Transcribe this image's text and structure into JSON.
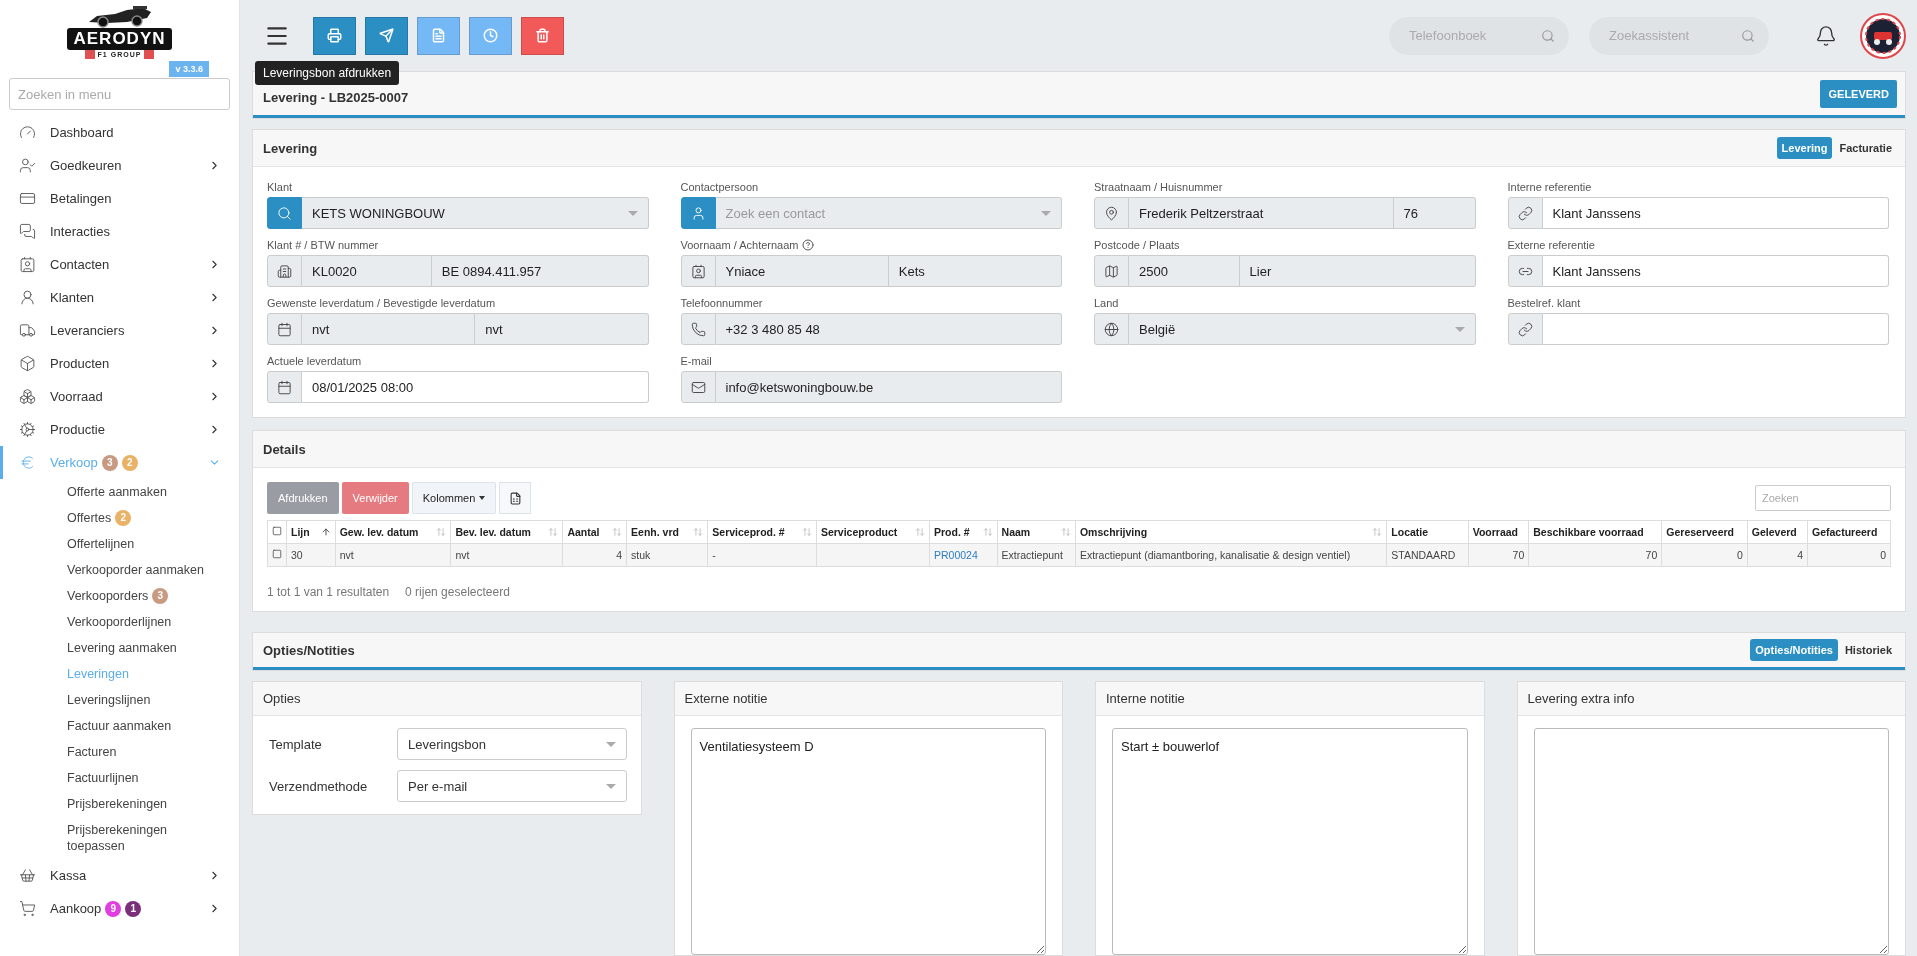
{
  "sidebar": {
    "brand": "AERODYN",
    "brand_subtitle": "F1 GROUP",
    "version": "v 3.3.6",
    "search": {
      "placeholder": "Zoeken in menu"
    },
    "items": [
      {
        "label": "Dashboard",
        "active": false
      },
      {
        "label": "Goedkeuren",
        "submenu": true,
        "active": false
      },
      {
        "label": "Betalingen",
        "active": false
      },
      {
        "label": "Interacties",
        "active": false
      },
      {
        "label": "Contacten",
        "submenu": true,
        "active": false
      },
      {
        "label": "Klanten",
        "submenu": true,
        "active": false
      },
      {
        "label": "Leveranciers",
        "submenu": true,
        "active": false
      },
      {
        "label": "Producten",
        "submenu": true,
        "active": false
      },
      {
        "label": "Voorraad",
        "submenu": true,
        "active": false
      },
      {
        "label": "Productie",
        "submenu": true,
        "active": false
      },
      {
        "label": "Verkoop",
        "submenu": true,
        "active": true,
        "expanded": true,
        "badges": [
          {
            "text": "3",
            "color": "#c99a82"
          },
          {
            "text": "2",
            "color": "#e9b266"
          }
        ],
        "children": [
          {
            "label": "Offerte aanmaken",
            "selected": false
          },
          {
            "label": "Offertes",
            "selected": false,
            "badges": [
              {
                "text": "2",
                "color": "#e9b266"
              }
            ]
          },
          {
            "label": "Offertelijnen",
            "selected": false
          },
          {
            "label": "Verkooporder aanmaken",
            "selected": false
          },
          {
            "label": "Verkooporders",
            "selected": false,
            "badges": [
              {
                "text": "3",
                "color": "#c99a82"
              }
            ]
          },
          {
            "label": "Verkooporderlijnen",
            "selected": false
          },
          {
            "label": "Levering aanmaken",
            "selected": false
          },
          {
            "label": "Leveringen",
            "selected": true
          },
          {
            "label": "Leveringslijnen",
            "selected": false
          },
          {
            "label": "Factuur aanmaken",
            "selected": false
          },
          {
            "label": "Facturen",
            "selected": false
          },
          {
            "label": "Factuurlijnen",
            "selected": false
          },
          {
            "label": "Prijsberekeningen",
            "selected": false
          },
          {
            "label": "Prijsberekeningen toepassen",
            "selected": false
          }
        ]
      },
      {
        "label": "Kassa",
        "submenu": true,
        "active": false
      },
      {
        "label": "Aankoop",
        "submenu": true,
        "active": false,
        "badges": [
          {
            "text": "9",
            "color": "#e03ee0"
          },
          {
            "text": "1",
            "color": "#7b2f7b"
          }
        ]
      }
    ]
  },
  "toolbar": {
    "buttons": [
      {
        "color": "#2b8fc4"
      },
      {
        "color": "#2b8fc4"
      },
      {
        "color": "#74b8f5"
      },
      {
        "color": "#74b8f5"
      },
      {
        "color": "#f25a5a"
      }
    ],
    "tooltip": "Leveringsbon afdrukken",
    "searches": [
      {
        "placeholder": "Telefoonboek"
      },
      {
        "placeholder": "Zoekassistent"
      }
    ]
  },
  "header": {
    "title": "Levering - LB2025-0007",
    "status": "GELEVERD"
  },
  "levering": {
    "title": "Levering",
    "tabs": [
      {
        "label": "Levering",
        "selected": true
      },
      {
        "label": "Facturatie",
        "selected": false
      }
    ],
    "columns": [
      {
        "fields": [
          {
            "label": "Klant",
            "kind": "select",
            "readonly": true,
            "accent": true,
            "parts": [
              {
                "value": "KETS WONINGBOUW"
              }
            ]
          },
          {
            "label": "Klant # / BTW nummer",
            "kind": "text",
            "readonly": true,
            "parts": [
              {
                "value": "KL0020"
              },
              {
                "value": "BE 0894.411.957"
              }
            ]
          },
          {
            "label": "Gewenste leverdatum / Bevestigde leverdatum",
            "kind": "text",
            "readonly": true,
            "parts": [
              {
                "value": "nvt"
              },
              {
                "value": "nvt"
              }
            ]
          },
          {
            "label": "Actuele leverdatum",
            "kind": "text",
            "readonly": false,
            "parts": [
              {
                "value": "08/01/2025 08:00"
              }
            ]
          }
        ]
      },
      {
        "fields": [
          {
            "label": "Contactpersoon",
            "kind": "select",
            "readonly": true,
            "accent": true,
            "parts": [
              {
                "placeholder": "Zoek een contact"
              }
            ]
          },
          {
            "label": "Voornaam / Achternaam",
            "help": true,
            "kind": "text",
            "readonly": true,
            "parts": [
              {
                "value": "Yniace"
              },
              {
                "value": "Kets"
              }
            ]
          },
          {
            "label": "Telefoonnummer",
            "kind": "text",
            "readonly": true,
            "parts": [
              {
                "value": "+32 3 480 85 48"
              }
            ]
          },
          {
            "label": "E-mail",
            "kind": "text",
            "readonly": true,
            "parts": [
              {
                "value": "info@ketswoningbouw.be"
              }
            ]
          }
        ]
      },
      {
        "fields": [
          {
            "label": "Straatnaam / Huisnummer",
            "kind": "text",
            "readonly": true,
            "parts": [
              {
                "value": "Frederik Peltzerstraat"
              },
              {
                "value": "76"
              }
            ]
          },
          {
            "label": "Postcode / Plaats",
            "kind": "text",
            "readonly": true,
            "parts": [
              {
                "value": "2500"
              },
              {
                "value": "Lier"
              }
            ]
          },
          {
            "label": "Land",
            "kind": "select",
            "readonly": true,
            "parts": [
              {
                "value": "België"
              }
            ]
          }
        ]
      },
      {
        "fields": [
          {
            "label": "Interne referentie",
            "kind": "text",
            "readonly": false,
            "parts": [
              {
                "value": "Klant Janssens"
              }
            ]
          },
          {
            "label": "Externe referentie",
            "kind": "text",
            "readonly": false,
            "parts": [
              {
                "value": "Klant Janssens"
              }
            ]
          },
          {
            "label": "Bestelref. klant",
            "kind": "text",
            "readonly": false
          }
        ]
      }
    ]
  },
  "details": {
    "title": "Details",
    "actions": [
      {
        "label": "Afdrukken",
        "kind": "grey"
      },
      {
        "label": "Verwijder",
        "kind": "danger"
      },
      {
        "label": "Kolommen",
        "kind": "dropdown"
      }
    ],
    "search": {
      "placeholder": "Zoeken"
    },
    "table": {
      "select_all": {
        "checked": false
      },
      "columns": [
        {
          "label": "Lijn",
          "kind": "text",
          "sortable": true,
          "sorted": true
        },
        {
          "label": "Gew. lev. datum",
          "kind": "text",
          "sortable": true
        },
        {
          "label": "Bev. lev. datum",
          "kind": "text",
          "sortable": true
        },
        {
          "label": "Aantal",
          "kind": "number",
          "sortable": true
        },
        {
          "label": "Eenh. vrd",
          "kind": "text",
          "sortable": true
        },
        {
          "label": "Serviceprod. #",
          "kind": "text",
          "sortable": true
        },
        {
          "label": "Serviceproduct",
          "kind": "text",
          "sortable": true
        },
        {
          "label": "Prod. #",
          "kind": "link",
          "sortable": true
        },
        {
          "label": "Naam",
          "kind": "text",
          "sortable": true
        },
        {
          "label": "Omschrijving",
          "kind": "text",
          "sortable": true
        },
        {
          "label": "Locatie",
          "kind": "text",
          "sortable": false
        },
        {
          "label": "Voorraad",
          "kind": "number",
          "sortable": false
        },
        {
          "label": "Beschikbare voorraad",
          "kind": "number",
          "sortable": false
        },
        {
          "label": "Gereserveerd",
          "kind": "number",
          "sortable": false
        },
        {
          "label": "Geleverd",
          "kind": "number",
          "sortable": false
        },
        {
          "label": "Gefactureerd",
          "kind": "number",
          "sortable": false
        }
      ],
      "rows": [
        {
          "checked": false,
          "cells": [
            "30",
            "nvt",
            "nvt",
            "4",
            "stuk",
            "-",
            null,
            "PR00024",
            "Extractiepunt",
            "Extractiepunt (diamantboring, kanalisatie & design ventiel)",
            "STANDAARD",
            "70",
            "70",
            "0",
            "4",
            "0"
          ]
        }
      ]
    },
    "footer": [
      "1 tot 1 van 1 resultaten",
      "0 rijen geselecteerd"
    ]
  },
  "opties": {
    "title": "Opties/Notities",
    "tabs": [
      {
        "label": "Opties/Notities",
        "selected": true
      },
      {
        "label": "Historiek",
        "selected": false
      }
    ],
    "options": {
      "title": "Opties",
      "rows": [
        {
          "label": "Template",
          "value": "Leveringsbon"
        },
        {
          "label": "Verzendmethode",
          "value": "Per e-mail"
        }
      ]
    },
    "notes": [
      {
        "title": "Externe notitie",
        "value": "Ventilatiesysteem D"
      },
      {
        "title": "Interne notitie",
        "value": "Start ± bouwerlof"
      },
      {
        "title": "Levering extra info"
      }
    ]
  }
}
